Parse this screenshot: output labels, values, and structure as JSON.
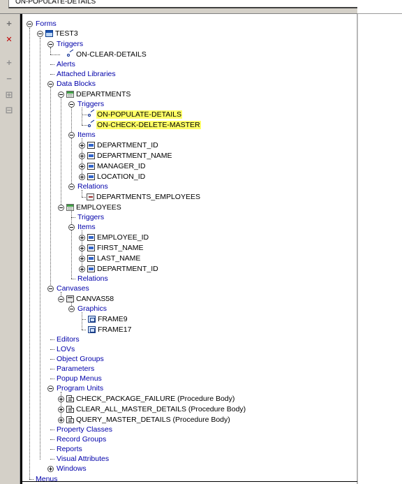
{
  "property_field": {
    "value": "ON-POPULATE-DETAILS"
  },
  "toolbar": {
    "buttons": [
      {
        "name": "create-button",
        "glyph": "+"
      },
      {
        "name": "delete-button",
        "glyph": "✕"
      },
      {
        "name": "expand-button",
        "glyph": "+"
      },
      {
        "name": "collapse-button",
        "glyph": "−"
      },
      {
        "name": "expand-all-button",
        "glyph": "⊞"
      },
      {
        "name": "collapse-all-button",
        "glyph": "⊟"
      }
    ]
  },
  "tree": {
    "forms": "Forms",
    "form_name": "TEST3",
    "triggers": "Triggers",
    "on_clear_details": "ON-CLEAR-DETAILS",
    "alerts": "Alerts",
    "attached_libraries": "Attached Libraries",
    "data_blocks": "Data Blocks",
    "departments": "DEPARTMENTS",
    "dept_triggers": "Triggers",
    "on_populate_details": "ON-POPULATE-DETAILS",
    "on_check_delete_master": "ON-CHECK-DELETE-MASTER",
    "dept_items": "Items",
    "department_id": "DEPARTMENT_ID",
    "department_name": "DEPARTMENT_NAME",
    "manager_id": "MANAGER_ID",
    "location_id": "LOCATION_ID",
    "dept_relations": "Relations",
    "departments_employees": "DEPARTMENTS_EMPLOYEES",
    "employees": "EMPLOYEES",
    "emp_triggers": "Triggers",
    "emp_items": "Items",
    "employee_id": "EMPLOYEE_ID",
    "first_name": "FIRST_NAME",
    "last_name": "LAST_NAME",
    "emp_department_id": "DEPARTMENT_ID",
    "emp_relations": "Relations",
    "canvases": "Canvases",
    "canvas58": "CANVAS58",
    "graphics": "Graphics",
    "frame9": "FRAME9",
    "frame17": "FRAME17",
    "editors": "Editors",
    "lovs": "LOVs",
    "object_groups": "Object Groups",
    "parameters": "Parameters",
    "popup_menus": "Popup Menus",
    "program_units": "Program Units",
    "check_package_failure": "CHECK_PACKAGE_FAILURE (Procedure Body)",
    "clear_all_master_details": "CLEAR_ALL_MASTER_DETAILS (Procedure Body)",
    "query_master_details": "QUERY_MASTER_DETAILS (Procedure Body)",
    "property_classes": "Property Classes",
    "record_groups": "Record Groups",
    "reports": "Reports",
    "visual_attributes": "Visual Attributes",
    "windows": "Windows",
    "menus": "Menus"
  },
  "colors": {
    "folder_text": "#0000aa",
    "highlight": "#ffff66",
    "toolbar_bg": "#d4d0c8"
  }
}
